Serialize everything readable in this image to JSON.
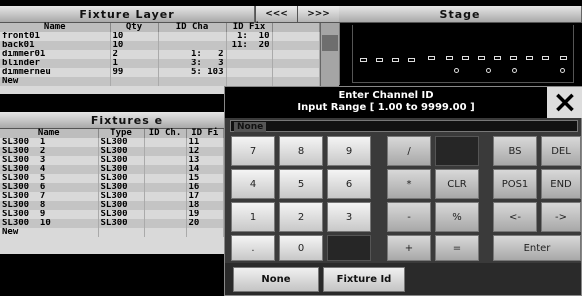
{
  "fixture_layer": {
    "title": "Fixture Layer",
    "prev": "<<<",
    "next": ">>>",
    "columns": [
      "Name",
      "Qty",
      "ID Cha",
      "ID Fix"
    ],
    "rows": [
      [
        "front01",
        "10",
        "",
        "1:  10"
      ],
      [
        "back01",
        "10",
        "",
        "11:  20"
      ],
      [
        "dimmer01",
        "2",
        "1:   2",
        ""
      ],
      [
        "blinder",
        "1",
        "3:   3",
        ""
      ],
      [
        "dimmerneu",
        "99",
        "5: 103",
        ""
      ],
      [
        "New",
        "",
        "",
        ""
      ]
    ]
  },
  "stage": {
    "title": "Stage"
  },
  "fixtures": {
    "title": "Fixtures e",
    "columns": [
      "Name",
      "Type",
      "ID Ch.",
      "ID Fi"
    ],
    "rows": [
      [
        "SL300  1",
        "SL300",
        "",
        "11"
      ],
      [
        "SL300  2",
        "SL300",
        "",
        "12"
      ],
      [
        "SL300  3",
        "SL300",
        "",
        "13"
      ],
      [
        "SL300  4",
        "SL300",
        "",
        "14"
      ],
      [
        "SL300  5",
        "SL300",
        "",
        "15"
      ],
      [
        "SL300  6",
        "SL300",
        "",
        "16"
      ],
      [
        "SL300  7",
        "SL300",
        "",
        "17"
      ],
      [
        "SL300  8",
        "SL300",
        "",
        "18"
      ],
      [
        "SL300  9",
        "SL300",
        "",
        "19"
      ],
      [
        "SL300  10",
        "SL300",
        "",
        "20"
      ],
      [
        "New",
        "",
        "",
        ""
      ]
    ]
  },
  "dialog": {
    "title_line1": "Enter Channel ID",
    "title_line2": "Input Range [ 1.00 to 9999.00 ]",
    "close_icon": "close-icon",
    "input_value": "None",
    "keys": {
      "k7": "7",
      "k8": "8",
      "k9": "9",
      "slash": "/",
      "k4": "4",
      "k5": "5",
      "k6": "6",
      "star": "*",
      "clr": "CLR",
      "k1": "1",
      "k2": "2",
      "k3": "3",
      "minus": "-",
      "percent": "%",
      "dot": ".",
      "k0": "0",
      "plus": "+",
      "equals": "=",
      "bs": "BS",
      "del": "DEL",
      "pos1": "POS1",
      "end": "END",
      "left": "<-",
      "right": "->",
      "enter": "Enter"
    },
    "bottom": {
      "none": "None",
      "fixture_id": "Fixture Id"
    }
  }
}
